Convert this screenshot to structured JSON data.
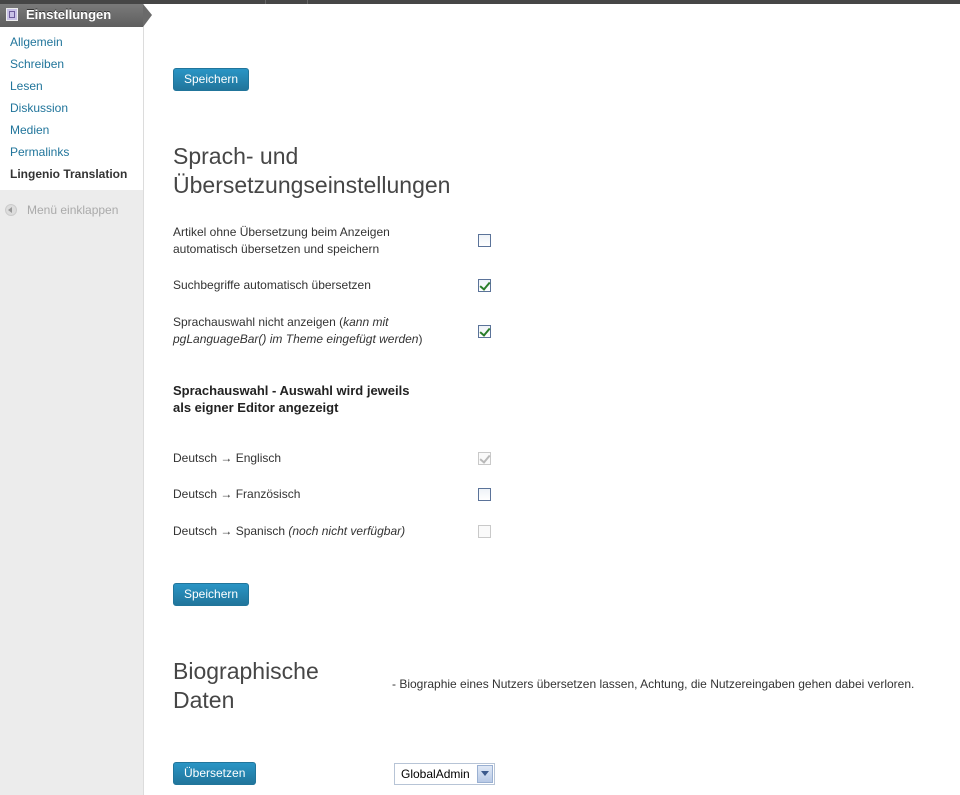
{
  "sidebar": {
    "header": {
      "label": "Einstellungen",
      "icon": "settings-plugin-icon"
    },
    "items": [
      {
        "label": "Allgemein"
      },
      {
        "label": "Schreiben"
      },
      {
        "label": "Lesen"
      },
      {
        "label": "Diskussion"
      },
      {
        "label": "Medien"
      },
      {
        "label": "Permalinks"
      },
      {
        "label": "Lingenio Translation",
        "current": true
      }
    ],
    "collapse_label": "Menü einklappen"
  },
  "buttons": {
    "save_top": "Speichern",
    "save_bottom": "Speichern",
    "translate": "Übersetzen"
  },
  "section_language": {
    "title_line1": "Sprach- und",
    "title_line2": "Übersetzungseinstellungen",
    "options": [
      {
        "line1": "Artikel ohne Übersetzung beim Anzeigen",
        "line2": "automatisch übersetzen und speichern",
        "checked": false
      },
      {
        "line1": "Suchbegriffe automatisch übersetzen",
        "checked": true
      },
      {
        "line1_plain": "Sprachauswahl nicht anzeigen (",
        "line1_italic": "kann mit",
        "line2_italic": "pgLanguageBar() im Theme eingefügt werden",
        "line2_plain": ")",
        "checked": true
      }
    ]
  },
  "section_selection": {
    "title_line1": "Sprachauswahl - Auswahl wird jeweils",
    "title_line2": "als eigner Editor angezeigt",
    "pairs": [
      {
        "label": "Deutsch → Englisch",
        "checked": true,
        "disabled": true
      },
      {
        "label": "Deutsch → Französisch",
        "checked": false,
        "disabled": false
      },
      {
        "label": "Deutsch → Spanisch ",
        "note": "(noch nicht verfügbar)",
        "checked": false,
        "disabled": true
      }
    ]
  },
  "section_bio": {
    "title_line1": "Biographische",
    "title_line2": "Daten",
    "description": "- Biographie eines Nutzers übersetzen lassen, Achtung, die Nutzereingaben gehen dabei verloren.",
    "user_select": {
      "value": "GlobalAdmin"
    }
  }
}
